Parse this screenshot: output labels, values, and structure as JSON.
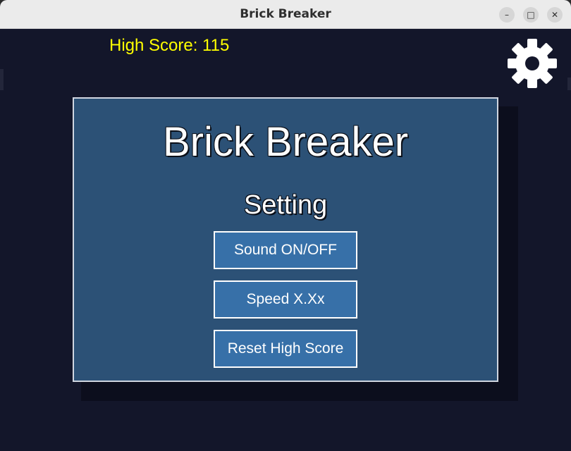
{
  "window": {
    "title": "Brick Breaker",
    "controls": {
      "minimize_icon": "–",
      "maximize_icon": "□",
      "close_icon": "✕"
    }
  },
  "hud": {
    "high_score_text": "High Score: 115",
    "settings_icon": "gear-icon",
    "high_score_color": "#ffff00"
  },
  "menu": {
    "title": "Brick Breaker",
    "subtitle": "Setting",
    "buttons": [
      {
        "label": "Sound ON/OFF"
      },
      {
        "label": "Speed X.Xx"
      },
      {
        "label": "Reset High Score"
      }
    ]
  },
  "colors": {
    "background": "#13162a",
    "panel": "#2c5176",
    "button": "#3770a8",
    "button_border": "#ffffff",
    "text": "#ffffff"
  }
}
